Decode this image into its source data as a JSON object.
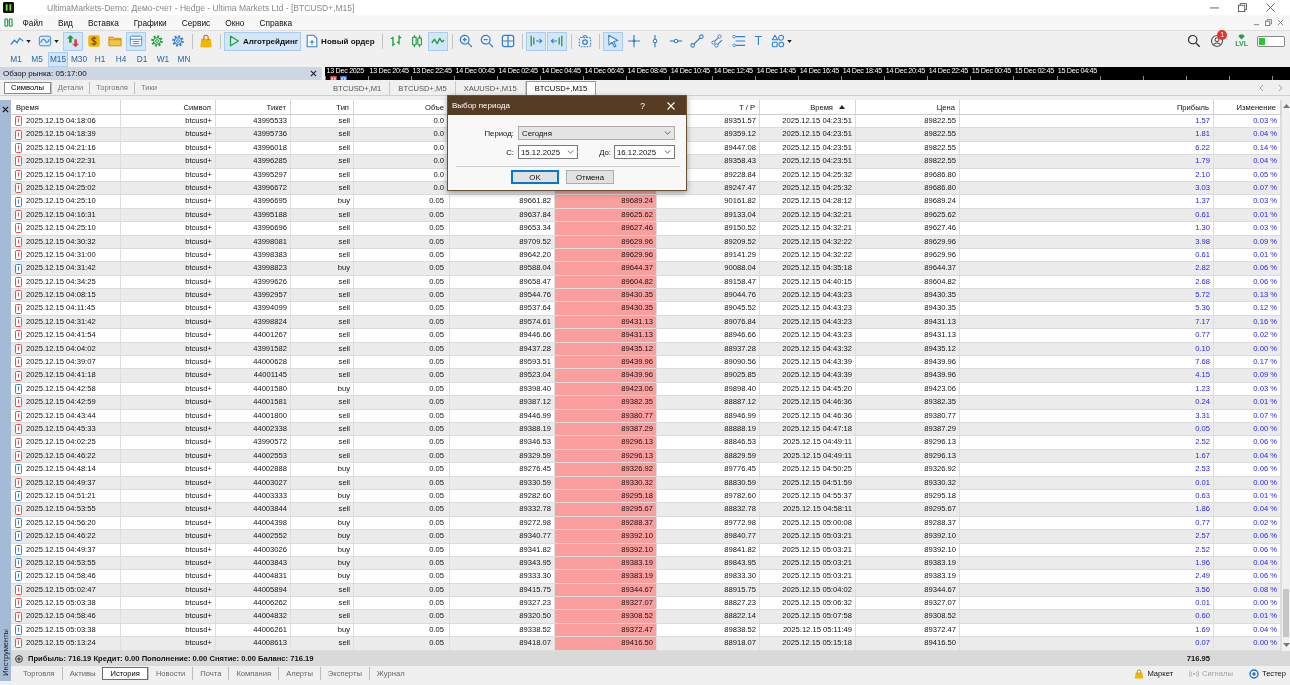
{
  "window": {
    "title": "UltimaMarkets-Demo: Демо-счет - Hedge - Ultima Markets Ltd - [BTCUSD+,M15]"
  },
  "menu": [
    "Файл",
    "Вид",
    "Вставка",
    "Графики",
    "Сервис",
    "Окно",
    "Справка"
  ],
  "toolbar": {
    "groups": [
      [
        {
          "selected": false
        },
        {
          "selected": false
        },
        {
          "selected": true
        },
        {
          "selected": false
        },
        {
          "selected": false
        },
        {
          "selected": true
        },
        {
          "selected": false
        },
        {
          "selected": false
        }
      ],
      [
        {
          "selected": false
        }
      ],
      [
        {
          "label": "Алготрейдинг",
          "selected": true
        },
        {
          "label": "Новый ордер",
          "selected": false
        }
      ],
      [
        {
          "selected": false
        },
        {
          "selected": false
        },
        {
          "selected": true
        }
      ],
      [
        {
          "selected": false
        },
        {
          "selected": false
        },
        {
          "selected": false
        }
      ],
      [
        {
          "selected": true
        },
        {
          "selected": true
        }
      ],
      [
        {
          "selected": false
        }
      ],
      [
        {
          "selected": true
        },
        {
          "selected": false
        },
        {
          "selected": false
        },
        {
          "selected": false
        },
        {
          "selected": false
        },
        {
          "selected": false
        },
        {
          "selected": false
        },
        {
          "label": "T",
          "selected": false
        },
        {
          "selected": false
        }
      ]
    ],
    "badge": "1",
    "lvl_label": "LVL"
  },
  "timeframes": [
    {
      "label": "M1",
      "selected": false
    },
    {
      "label": "M5",
      "selected": false
    },
    {
      "label": "M15",
      "selected": true
    },
    {
      "label": "M30",
      "selected": false
    },
    {
      "label": "H1",
      "selected": false
    },
    {
      "label": "H4",
      "selected": false
    },
    {
      "label": "D1",
      "selected": false
    },
    {
      "label": "W1",
      "selected": false
    },
    {
      "label": "MN",
      "selected": false
    }
  ],
  "market_watch": {
    "title": "Обзор рынка: 05:17:00",
    "tabs": [
      {
        "label": "Символы",
        "selected": true
      },
      {
        "label": "Детали",
        "selected": false
      },
      {
        "label": "Торговля",
        "selected": false
      },
      {
        "label": "Тики",
        "selected": false
      }
    ]
  },
  "chart": {
    "time_axis": [
      "13 Dec 2025",
      "13 Dec 20:45",
      "13 Dec 22:45",
      "14 Dec 00:45",
      "14 Dec 02:45",
      "14 Dec 04:45",
      "14 Dec 06:45",
      "14 Dec 08:45",
      "14 Dec 10:45",
      "14 Dec 12:45",
      "14 Dec 14:45",
      "14 Dec 16:45",
      "14 Dec 18:45",
      "14 Dec 20:45",
      "14 Dec 22:45",
      "15 Dec 00:45",
      "15 Dec 02:45",
      "15 Dec 04:45"
    ],
    "tabs": [
      {
        "label": "BTCUSD+,M1",
        "selected": false
      },
      {
        "label": "BTCUSD+,M5",
        "selected": false
      },
      {
        "label": "XAUUSD+,M15",
        "selected": false
      },
      {
        "label": "BTCUSD+,M15",
        "selected": true
      }
    ]
  },
  "toolbox": {
    "side_label": "Инструменты",
    "columns": [
      {
        "label": "Время",
        "sorted": false
      },
      {
        "label": "Символ",
        "sorted": false
      },
      {
        "label": "Тикет",
        "sorted": false
      },
      {
        "label": "Тип",
        "sorted": false
      },
      {
        "label": "Объе",
        "sorted": false
      },
      null,
      null,
      {
        "label": "T / P",
        "sorted": false
      },
      {
        "label": "Время",
        "sorted": true
      },
      {
        "label": "Цена",
        "sorted": false
      },
      {
        "label": "Прибыль",
        "sorted": false
      },
      {
        "label": "Изменение",
        "sorted": false
      }
    ],
    "rows": [
      {
        "time": "2025.12.15 04:18:06",
        "symbol": "btcusd+",
        "ticket": "43995533",
        "type": "sell",
        "volume": "0.0",
        "tp": "89351.57",
        "close_time": "2025.12.15 04:23:51",
        "close_price": "89822.55",
        "profit": "1.57",
        "change": "0.03 %",
        "color": "#e05252"
      },
      {
        "time": "2025.12.15 04:18:39",
        "symbol": "btcusd+",
        "ticket": "43995736",
        "type": "sell",
        "volume": "0.0",
        "tp": "89359.12",
        "close_time": "2025.12.15 04:23:51",
        "close_price": "89822.55",
        "profit": "1.81",
        "change": "0.04 %",
        "color": "#e05252"
      },
      {
        "time": "2025.12.15 04:21:16",
        "symbol": "btcusd+",
        "ticket": "43996018",
        "type": "sell",
        "volume": "0.0",
        "tp": "89447.08",
        "close_time": "2025.12.15 04:23:51",
        "close_price": "89822.55",
        "profit": "6.22",
        "change": "0.14 %",
        "color": "#e05252"
      },
      {
        "time": "2025.12.15 04:22:31",
        "symbol": "btcusd+",
        "ticket": "43996285",
        "type": "sell",
        "volume": "0.0",
        "tp": "89358.43",
        "close_time": "2025.12.15 04:23:51",
        "close_price": "89822.55",
        "profit": "1.79",
        "change": "0.04 %",
        "color": "#e05252"
      },
      {
        "time": "2025.12.15 04:17:10",
        "symbol": "btcusd+",
        "ticket": "43995297",
        "type": "sell",
        "volume": "0.0",
        "tp": "89228.84",
        "close_time": "2025.12.15 04:25:32",
        "close_price": "89686.80",
        "profit": "2.10",
        "change": "0.05 %",
        "color": "#e05252"
      },
      {
        "time": "2025.12.15 04:25:02",
        "symbol": "btcusd+",
        "ticket": "43996672",
        "type": "sell",
        "volume": "0.0",
        "tp": "89247.47",
        "close_time": "2025.12.15 04:25:32",
        "close_price": "89686.80",
        "profit": "3.03",
        "change": "0.07 %",
        "color": "#e05252"
      },
      {
        "time": "2025.12.15 04:25:10",
        "symbol": "btcusd+",
        "ticket": "43996695",
        "type": "buy",
        "volume": "0.05",
        "price": "89661.82",
        "sl": "89689.24",
        "tp": "90161.82",
        "close_time": "2025.12.15 04:28:12",
        "close_price": "89689.24",
        "profit": "1.37",
        "change": "0.03 %",
        "color": "#3d7fd6"
      },
      {
        "time": "2025.12.15 04:16:31",
        "symbol": "btcusd+",
        "ticket": "43995188",
        "type": "sell",
        "volume": "0.05",
        "price": "89637.84",
        "sl": "89625.62",
        "tp": "89133.04",
        "close_time": "2025.12.15 04:32:21",
        "close_price": "89625.62",
        "profit": "0.61",
        "change": "0.01 %",
        "color": "#e05252"
      },
      {
        "time": "2025.12.15 04:25:10",
        "symbol": "btcusd+",
        "ticket": "43996696",
        "type": "sell",
        "volume": "0.05",
        "price": "89653.34",
        "sl": "89627.46",
        "tp": "89150.52",
        "close_time": "2025.12.15 04:32:21",
        "close_price": "89627.46",
        "profit": "1.30",
        "change": "0.03 %",
        "color": "#e05252"
      },
      {
        "time": "2025.12.15 04:30:32",
        "symbol": "btcusd+",
        "ticket": "43998081",
        "type": "sell",
        "volume": "0.05",
        "price": "89709.52",
        "sl": "89629.96",
        "tp": "89209.52",
        "close_time": "2025.12.15 04:32:22",
        "close_price": "89629.96",
        "profit": "3.98",
        "change": "0.09 %",
        "color": "#e05252"
      },
      {
        "time": "2025.12.15 04:31:00",
        "symbol": "btcusd+",
        "ticket": "43998383",
        "type": "sell",
        "volume": "0.05",
        "price": "89642.20",
        "sl": "89629.96",
        "tp": "89141.29",
        "close_time": "2025.12.15 04:32:22",
        "close_price": "89629.96",
        "profit": "0.61",
        "change": "0.01 %",
        "color": "#e05252"
      },
      {
        "time": "2025.12.15 04:31:42",
        "symbol": "btcusd+",
        "ticket": "43998823",
        "type": "buy",
        "volume": "0.05",
        "price": "89588.04",
        "sl": "89644.37",
        "tp": "90088.04",
        "close_time": "2025.12.15 04:35:18",
        "close_price": "89644.37",
        "profit": "2.82",
        "change": "0.06 %",
        "color": "#3d7fd6"
      },
      {
        "time": "2025.12.15 04:34:25",
        "symbol": "btcusd+",
        "ticket": "43999626",
        "type": "sell",
        "volume": "0.05",
        "price": "89658.47",
        "sl": "89604.82",
        "tp": "89158.47",
        "close_time": "2025.12.15 04:40:15",
        "close_price": "89604.82",
        "profit": "2.68",
        "change": "0.06 %",
        "color": "#e05252"
      },
      {
        "time": "2025.12.15 04:08:15",
        "symbol": "btcusd+",
        "ticket": "43992957",
        "type": "sell",
        "volume": "0.05",
        "price": "89544.76",
        "sl": "89430.35",
        "tp": "89044.76",
        "close_time": "2025.12.15 04:43:23",
        "close_price": "89430.35",
        "profit": "5.72",
        "change": "0.13 %",
        "color": "#e05252"
      },
      {
        "time": "2025.12.15 04:11:45",
        "symbol": "btcusd+",
        "ticket": "43994099",
        "type": "sell",
        "volume": "0.05",
        "price": "89537.64",
        "sl": "89430.35",
        "tp": "89045.52",
        "close_time": "2025.12.15 04:43:23",
        "close_price": "89430.35",
        "profit": "5.36",
        "change": "0.12 %",
        "color": "#e05252"
      },
      {
        "time": "2025.12.15 04:31:42",
        "symbol": "btcusd+",
        "ticket": "43998824",
        "type": "sell",
        "volume": "0.05",
        "price": "89574.61",
        "sl": "89431.13",
        "tp": "89076.84",
        "close_time": "2025.12.15 04:43:23",
        "close_price": "89431.13",
        "profit": "7.17",
        "change": "0.16 %",
        "color": "#e05252"
      },
      {
        "time": "2025.12.15 04:41:54",
        "symbol": "btcusd+",
        "ticket": "44001267",
        "type": "sell",
        "volume": "0.05",
        "price": "89446.66",
        "sl": "89431.13",
        "tp": "88946.66",
        "close_time": "2025.12.15 04:43:23",
        "close_price": "89431.13",
        "profit": "0.77",
        "change": "0.02 %",
        "color": "#e05252"
      },
      {
        "time": "2025.12.15 04:04:02",
        "symbol": "btcusd+",
        "ticket": "43991582",
        "type": "sell",
        "volume": "0.05",
        "price": "89437.28",
        "sl": "89435.12",
        "tp": "88937.28",
        "close_time": "2025.12.15 04:43:32",
        "close_price": "89435.12",
        "profit": "0.10",
        "change": "0.00 %",
        "color": "#e05252"
      },
      {
        "time": "2025.12.15 04:39:07",
        "symbol": "btcusd+",
        "ticket": "44000628",
        "type": "sell",
        "volume": "0.05",
        "price": "89593.51",
        "sl": "89439.96",
        "tp": "89090.56",
        "close_time": "2025.12.15 04:43:39",
        "close_price": "89439.96",
        "profit": "7.68",
        "change": "0.17 %",
        "color": "#e05252"
      },
      {
        "time": "2025.12.15 04:41:18",
        "symbol": "btcusd+",
        "ticket": "44001145",
        "type": "sell",
        "volume": "0.05",
        "price": "89523.04",
        "sl": "89439.96",
        "tp": "89025.85",
        "close_time": "2025.12.15 04:43:39",
        "close_price": "89439.96",
        "profit": "4.15",
        "change": "0.09 %",
        "color": "#e05252"
      },
      {
        "time": "2025.12.15 04:42:58",
        "symbol": "btcusd+",
        "ticket": "44001580",
        "type": "buy",
        "volume": "0.05",
        "price": "89398.40",
        "sl": "89423.06",
        "tp": "89898.40",
        "close_time": "2025.12.15 04:45:20",
        "close_price": "89423.06",
        "profit": "1.23",
        "change": "0.03 %",
        "color": "#3d7fd6"
      },
      {
        "time": "2025.12.15 04:42:59",
        "symbol": "btcusd+",
        "ticket": "44001581",
        "type": "sell",
        "volume": "0.05",
        "price": "89387.12",
        "sl": "89382.35",
        "tp": "88887.12",
        "close_time": "2025.12.15 04:46:36",
        "close_price": "89382.35",
        "profit": "0.24",
        "change": "0.01 %",
        "color": "#e05252"
      },
      {
        "time": "2025.12.15 04:43:44",
        "symbol": "btcusd+",
        "ticket": "44001800",
        "type": "sell",
        "volume": "0.05",
        "price": "89446.99",
        "sl": "89380.77",
        "tp": "88946.99",
        "close_time": "2025.12.15 04:46:36",
        "close_price": "89380.77",
        "profit": "3.31",
        "change": "0.07 %",
        "color": "#e05252"
      },
      {
        "time": "2025.12.15 04:45:33",
        "symbol": "btcusd+",
        "ticket": "44002338",
        "type": "sell",
        "volume": "0.05",
        "price": "89388.19",
        "sl": "89387.29",
        "tp": "88888.19",
        "close_time": "2025.12.15 04:47:18",
        "close_price": "89387.29",
        "profit": "0.05",
        "change": "0.00 %",
        "color": "#e05252"
      },
      {
        "time": "2025.12.15 04:02:25",
        "symbol": "btcusd+",
        "ticket": "43990572",
        "type": "sell",
        "volume": "0.05",
        "price": "89346.53",
        "sl": "89296.13",
        "tp": "88846.53",
        "close_time": "2025.12.15 04:49:11",
        "close_price": "89296.13",
        "profit": "2.52",
        "change": "0.06 %",
        "color": "#e05252"
      },
      {
        "time": "2025.12.15 04:46:22",
        "symbol": "btcusd+",
        "ticket": "44002553",
        "type": "sell",
        "volume": "0.05",
        "price": "89329.59",
        "sl": "89296.13",
        "tp": "88829.59",
        "close_time": "2025.12.15 04:49:11",
        "close_price": "89296.13",
        "profit": "1.67",
        "change": "0.04 %",
        "color": "#e05252"
      },
      {
        "time": "2025.12.15 04:48:14",
        "symbol": "btcusd+",
        "ticket": "44002888",
        "type": "buy",
        "volume": "0.05",
        "price": "89276.45",
        "sl": "89326.92",
        "tp": "89776.45",
        "close_time": "2025.12.15 04:50:25",
        "close_price": "89326.92",
        "profit": "2.53",
        "change": "0.06 %",
        "color": "#3d7fd6"
      },
      {
        "time": "2025.12.15 04:49:37",
        "symbol": "btcusd+",
        "ticket": "44003027",
        "type": "sell",
        "volume": "0.05",
        "price": "89330.59",
        "sl": "89330.32",
        "tp": "88830.59",
        "close_time": "2025.12.15 04:51:59",
        "close_price": "89330.32",
        "profit": "0.01",
        "change": "0.00 %",
        "color": "#e05252"
      },
      {
        "time": "2025.12.15 04:51:21",
        "symbol": "btcusd+",
        "ticket": "44003333",
        "type": "buy",
        "volume": "0.05",
        "price": "89282.60",
        "sl": "89295.18",
        "tp": "89782.60",
        "close_time": "2025.12.15 04:55:37",
        "close_price": "89295.18",
        "profit": "0.63",
        "change": "0.01 %",
        "color": "#3d7fd6"
      },
      {
        "time": "2025.12.15 04:53:55",
        "symbol": "btcusd+",
        "ticket": "44003844",
        "type": "sell",
        "volume": "0.05",
        "price": "89332.78",
        "sl": "89295.67",
        "tp": "88832.78",
        "close_time": "2025.12.15 04:58:11",
        "close_price": "89295.67",
        "profit": "1.86",
        "change": "0.04 %",
        "color": "#e05252"
      },
      {
        "time": "2025.12.15 04:56:20",
        "symbol": "btcusd+",
        "ticket": "44004398",
        "type": "buy",
        "volume": "0.05",
        "price": "89272.98",
        "sl": "89288.37",
        "tp": "89772.98",
        "close_time": "2025.12.15 05:00:08",
        "close_price": "89288.37",
        "profit": "0.77",
        "change": "0.02 %",
        "color": "#3d7fd6"
      },
      {
        "time": "2025.12.15 04:46:22",
        "symbol": "btcusd+",
        "ticket": "44002552",
        "type": "buy",
        "volume": "0.05",
        "price": "89340.77",
        "sl": "89392.10",
        "tp": "89840.77",
        "close_time": "2025.12.15 05:03:21",
        "close_price": "89392.10",
        "profit": "2.57",
        "change": "0.06 %",
        "color": "#3d7fd6"
      },
      {
        "time": "2025.12.15 04:49:37",
        "symbol": "btcusd+",
        "ticket": "44003026",
        "type": "buy",
        "volume": "0.05",
        "price": "89341.82",
        "sl": "89392.10",
        "tp": "89841.82",
        "close_time": "2025.12.15 05:03:21",
        "close_price": "89392.10",
        "profit": "2.52",
        "change": "0.06 %",
        "color": "#3d7fd6"
      },
      {
        "time": "2025.12.15 04:53:55",
        "symbol": "btcusd+",
        "ticket": "44003843",
        "type": "buy",
        "volume": "0.05",
        "price": "89343.95",
        "sl": "89383.19",
        "tp": "89843.95",
        "close_time": "2025.12.15 05:03:21",
        "close_price": "89383.19",
        "profit": "1.96",
        "change": "0.04 %",
        "color": "#3d7fd6"
      },
      {
        "time": "2025.12.15 04:58:46",
        "symbol": "btcusd+",
        "ticket": "44004831",
        "type": "buy",
        "volume": "0.05",
        "price": "89333.30",
        "sl": "89383.19",
        "tp": "89833.30",
        "close_time": "2025.12.15 05:03:21",
        "close_price": "89383.19",
        "profit": "2.49",
        "change": "0.06 %",
        "color": "#3d7fd6"
      },
      {
        "time": "2025.12.15 05:02:47",
        "symbol": "btcusd+",
        "ticket": "44005894",
        "type": "sell",
        "volume": "0.05",
        "price": "89415.75",
        "sl": "89344.67",
        "tp": "88915.75",
        "close_time": "2025.12.15 05:04:02",
        "close_price": "89344.67",
        "profit": "3.56",
        "change": "0.08 %",
        "color": "#e05252"
      },
      {
        "time": "2025.12.15 05:03:38",
        "symbol": "btcusd+",
        "ticket": "44006262",
        "type": "sell",
        "volume": "0.05",
        "price": "89327.23",
        "sl": "89327.07",
        "tp": "88827.23",
        "close_time": "2025.12.15 05:06:32",
        "close_price": "89327.07",
        "profit": "0.01",
        "change": "0.00 %",
        "color": "#e05252"
      },
      {
        "time": "2025.12.15 04:58:46",
        "symbol": "btcusd+",
        "ticket": "44004832",
        "type": "sell",
        "volume": "0.05",
        "price": "89320.50",
        "sl": "89308.52",
        "tp": "88822.14",
        "close_time": "2025.12.15 05:07:58",
        "close_price": "89308.52",
        "profit": "0.60",
        "change": "0.01 %",
        "color": "#e05252"
      },
      {
        "time": "2025.12.15 05:03:38",
        "symbol": "btcusd+",
        "ticket": "44006261",
        "type": "buy",
        "volume": "0.05",
        "price": "89338.52",
        "sl": "89372.47",
        "tp": "89838.52",
        "close_time": "2025.12.15 05:11:49",
        "close_price": "89372.47",
        "profit": "1.69",
        "change": "0.04 %",
        "color": "#3d7fd6"
      },
      {
        "time": "2025.12.15 05:13:24",
        "symbol": "btcusd+",
        "ticket": "44008613",
        "type": "sell",
        "volume": "0.05",
        "price": "89418.07",
        "sl": "89416.50",
        "tp": "88918.07",
        "close_time": "2025.12.15 05:15:18",
        "close_price": "89416.50",
        "profit": "0.07",
        "change": "0.00 %",
        "color": "#e05252"
      }
    ],
    "summary": "Прибыль: 716.19 Кредит: 0.00 Пополнение: 0.00 Снятие: 0.00 Баланс: 716.19",
    "total": "716.95",
    "tabs": [
      {
        "label": "Торговля",
        "selected": false
      },
      {
        "label": "Активы",
        "selected": false
      },
      {
        "label": "История",
        "selected": true
      },
      {
        "label": "Новости",
        "selected": false
      },
      {
        "label": "Почта",
        "selected": false
      },
      {
        "label": "Компания",
        "selected": false
      },
      {
        "label": "Алерты",
        "selected": false
      },
      {
        "label": "Эксперты",
        "selected": false
      },
      {
        "label": "Журнал",
        "selected": false
      }
    ],
    "actions": [
      {
        "label": "Маркет",
        "disabled": false
      },
      {
        "label": "Сигналы",
        "disabled": true
      },
      {
        "label": "Тестер",
        "disabled": false
      }
    ]
  },
  "dialog": {
    "title": "Выбор периода",
    "help": "?",
    "period_label": "Период:",
    "period_value": "Сегодня",
    "from_label": "С:",
    "from_value": "15.12.2025",
    "to_label": "До:",
    "to_value": "16.12.2025",
    "buttons": [
      {
        "label": "OK",
        "default": true
      },
      {
        "label": "Отмена",
        "default": false
      }
    ]
  }
}
